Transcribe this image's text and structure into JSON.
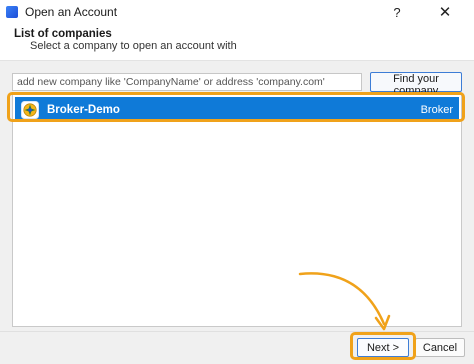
{
  "window": {
    "title": "Open an Account",
    "help_symbol": "?",
    "close_symbol": "✕"
  },
  "header": {
    "title": "List of companies",
    "subtitle": "Select a company to open an account with"
  },
  "search": {
    "placeholder": "add new company like 'CompanyName' or address 'company.com'",
    "value": ""
  },
  "find_button": {
    "label": "Find your company"
  },
  "companies": [
    {
      "name": "Broker-Demo",
      "type": "Broker",
      "selected": true,
      "icon": "broker-logo-icon"
    }
  ],
  "footer": {
    "next_label": "Next >",
    "cancel_label": "Cancel"
  },
  "colors": {
    "selection": "#0f7ad8",
    "annotation_highlight": "#f0a21a",
    "button_focus_border": "#3d7dd6"
  }
}
